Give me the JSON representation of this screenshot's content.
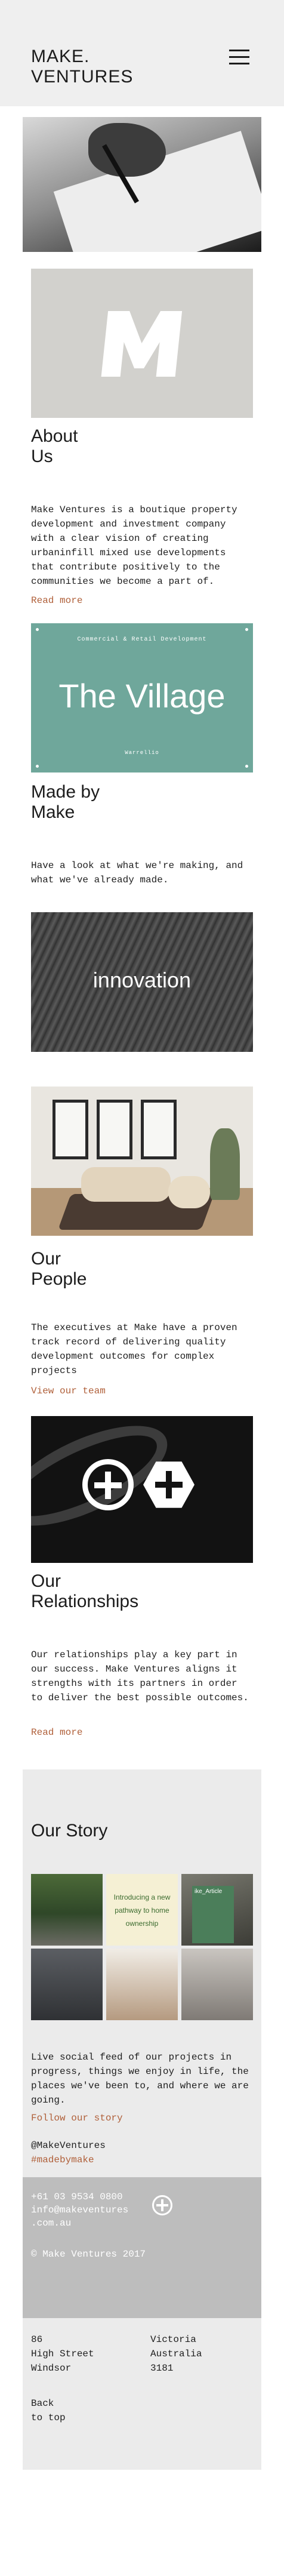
{
  "header": {
    "logo_line1": "MAKE.",
    "logo_line2": "VENTURES",
    "menu_icon": "hamburger-menu-icon"
  },
  "about": {
    "heading_line1": "About",
    "heading_line2": "Us",
    "body": "Make Ventures is a boutique property development and investment company with a clear vision of creating urbaninfill mixed use developments that contribute positively to the communities we become a part of.",
    "link": "Read more"
  },
  "village": {
    "sub": "Commercial & Retail Development",
    "title": "The Village",
    "location": "Warrellio"
  },
  "made_by": {
    "heading_line1": "Made by",
    "heading_line2": "Make",
    "body": "Have a look at what we're making, and what we've already made.",
    "tile_label": "innovation"
  },
  "people": {
    "heading_line1": "Our",
    "heading_line2": "People",
    "body": "The executives at Make have a proven track record of delivering quality development outcomes for complex projects",
    "link": "View our team"
  },
  "relationships": {
    "heading_line1": "Our",
    "heading_line2": "Relationships",
    "body": "Our relationships play a key part in our success. Make Ventures aligns it strengths with its partners in order to deliver the best possible outcomes.",
    "link": "Read more"
  },
  "story": {
    "heading": "Our Story",
    "promo_text": "Introducing a new pathway to home ownership",
    "magazine_label": "ike_Article",
    "body": "Live social feed of our projects in progress, things we enjoy in life, the places we've been to, and where we are going.",
    "link": "Follow our story",
    "handle": "@MakeVentures",
    "hashtag": "#madebymake"
  },
  "footer": {
    "phone": "+61 03 9534 0800",
    "email_line1": "info@makeventures",
    "email_line2": ".com.au",
    "copyright": "© Make Ventures 2017",
    "addr_col1": [
      "86",
      "High Street",
      "Windsor"
    ],
    "addr_col2": [
      "Victoria",
      "Australia",
      "3181"
    ],
    "back_line1": "Back",
    "back_line2": "to top"
  },
  "colors": {
    "accent_link": "#b0603a",
    "village_bg": "#6fa79b",
    "header_bg": "#efefef",
    "footer_bg": "#bdbdbd"
  }
}
